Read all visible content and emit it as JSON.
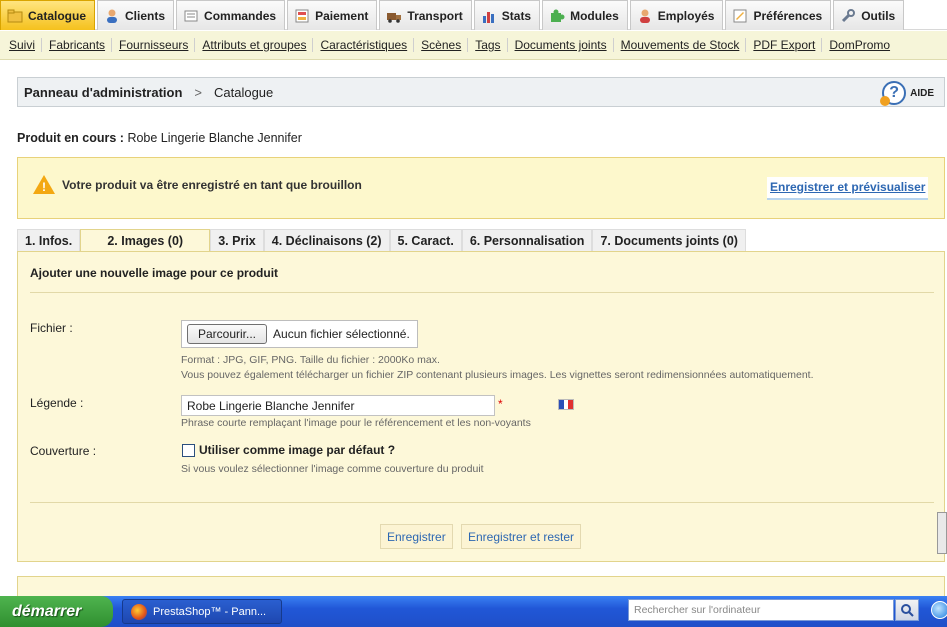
{
  "topnav": [
    {
      "label": "Catalogue",
      "icon": "folder-icon",
      "active": true
    },
    {
      "label": "Clients",
      "icon": "user-icon"
    },
    {
      "label": "Commandes",
      "icon": "cart-icon"
    },
    {
      "label": "Paiement",
      "icon": "payment-icon"
    },
    {
      "label": "Transport",
      "icon": "truck-icon"
    },
    {
      "label": "Stats",
      "icon": "bar-chart-icon"
    },
    {
      "label": "Modules",
      "icon": "puzzle-icon"
    },
    {
      "label": "Employés",
      "icon": "employee-icon"
    },
    {
      "label": "Préférences",
      "icon": "preferences-icon"
    },
    {
      "label": "Outils",
      "icon": "wrench-icon"
    }
  ],
  "subnav": [
    "Suivi",
    "Fabricants",
    "Fournisseurs",
    "Attributs et groupes",
    "Caractéristiques",
    "Scènes",
    "Tags",
    "Documents joints",
    "Mouvements de Stock",
    "PDF Export",
    "DomPromo"
  ],
  "breadcrumb": {
    "admin": "Panneau d'administration",
    "separator": ">",
    "current": "Catalogue"
  },
  "help": {
    "label": "AIDE"
  },
  "current_product": {
    "label": "Produit en cours :",
    "name": "Robe Lingerie Blanche Jennifer"
  },
  "warning": {
    "message": "Votre produit va être enregistré en tant que brouillon",
    "preview_link": "Enregistrer et prévisualiser"
  },
  "product_tabs": [
    {
      "label": "1. Infos."
    },
    {
      "label": "2. Images (0)",
      "active": true
    },
    {
      "label": "3. Prix"
    },
    {
      "label": "4. Déclinaisons (2)"
    },
    {
      "label": "5. Caract."
    },
    {
      "label": "6. Personnalisation"
    },
    {
      "label": "7. Documents joints (0)"
    }
  ],
  "form": {
    "heading": "Ajouter une nouvelle image pour ce produit",
    "file_label": "Fichier :",
    "browse_button": "Parcourir...",
    "no_file": "Aucun fichier sélectionné.",
    "file_hint_1": "Format : JPG, GIF, PNG. Taille du fichier : 2000Ko max.",
    "file_hint_2": "Vous pouvez également télécharger un fichier ZIP contenant plusieurs images. Les vignettes seront redimensionnées automatiquement.",
    "legend_label": "Légende :",
    "legend_value": "Robe Lingerie Blanche Jennifer",
    "required_mark": "*",
    "legend_hint": "Phrase courte remplaçant l'image pour le référencement et les non-voyants",
    "cover_label": "Couverture :",
    "cover_checkbox": "Utiliser comme image par défaut ?",
    "cover_hint": "Si vous voulez sélectionner l'image comme couverture du produit",
    "save_button": "Enregistrer",
    "save_stay_button": "Enregistrer et rester"
  },
  "taskbar": {
    "start": "démarrer",
    "task_title": "PrestaShop™ - Pann...",
    "search_placeholder": "Rechercher sur l'ordinateur"
  },
  "colors": {
    "active_tab": "#f5c11d",
    "panel_bg": "#fdf8d9",
    "link": "#2d67b2",
    "warning_icon": "#f3a812"
  }
}
